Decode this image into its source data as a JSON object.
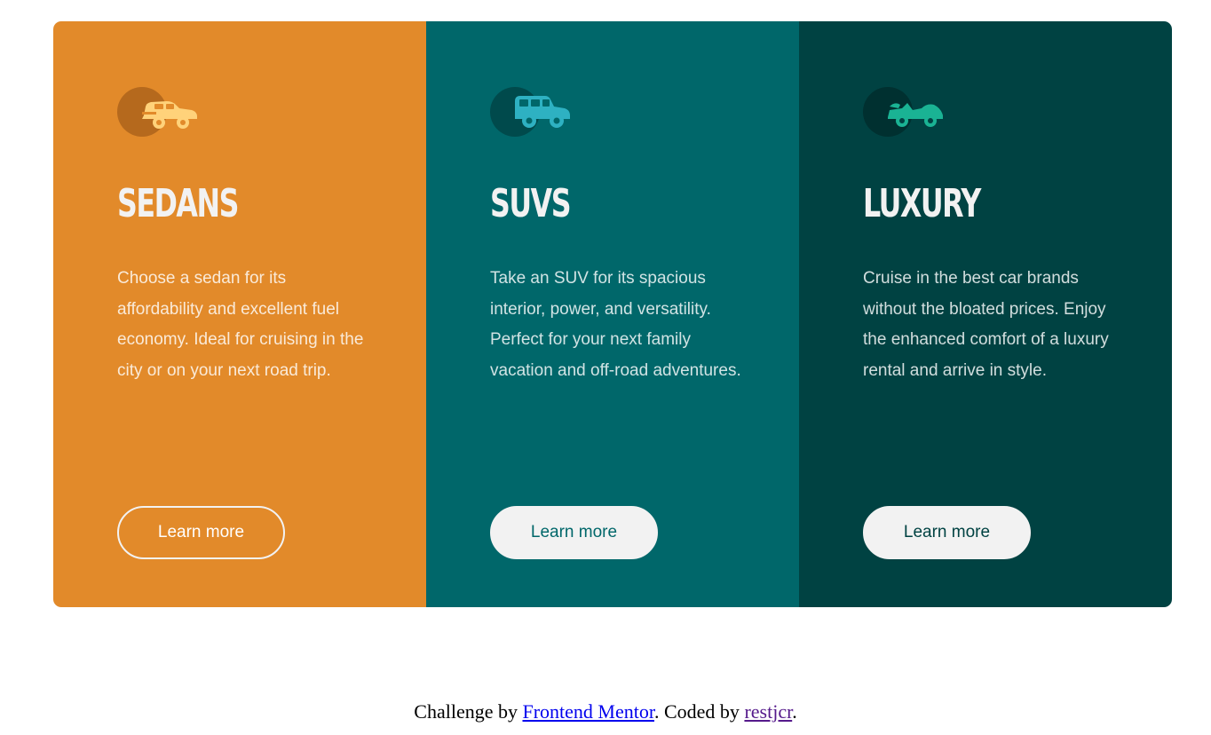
{
  "colors": {
    "sedans_bg": "#e28a2a",
    "suvs_bg": "#00676a",
    "luxury_bg": "#004242",
    "heading": "#f2f2f2",
    "button_bg": "#f2f2f2"
  },
  "cards": [
    {
      "icon": "sedan-car-icon",
      "title": "SEDANS",
      "text": "Choose a sedan for its affordability and excellent fuel economy. Ideal for cruising in the city or on your next road trip.",
      "button": "Learn more"
    },
    {
      "icon": "suv-car-icon",
      "title": "SUVS",
      "text": "Take an SUV for its spacious interior, power, and versatility. Perfect for your next family vacation and off-road adventures.",
      "button": "Learn more"
    },
    {
      "icon": "luxury-car-icon",
      "title": "LUXURY",
      "text": "Cruise in the best car brands without the bloated prices. Enjoy the enhanced comfort of a luxury rental and arrive in style.",
      "button": "Learn more"
    }
  ],
  "attribution": {
    "prefix": "Challenge by ",
    "challenge_link": "Frontend Mentor",
    "middle": ". Coded by ",
    "author_link": "restjcr",
    "suffix": "."
  }
}
